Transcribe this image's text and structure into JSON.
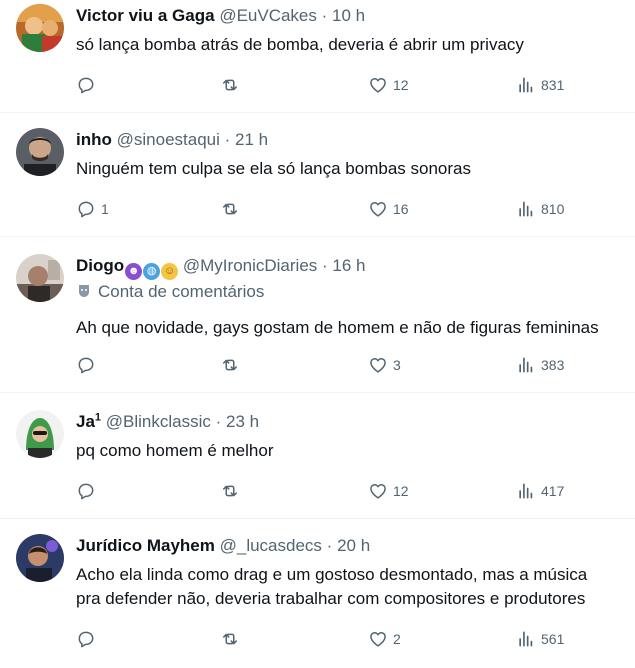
{
  "tweets": [
    {
      "name": "Victor viu a Gaga",
      "handle": "@EuVCakes",
      "time": "10 h",
      "label": "",
      "text": [
        "só lança bomba atrás de bomba, deveria é abrir um privacy"
      ],
      "replies": "",
      "retweets": "",
      "likes": "12",
      "views": "831"
    },
    {
      "name": "inho",
      "handle": "@sinoestaqui",
      "time": "21 h",
      "label": "",
      "text": [
        "Ninguém tem culpa se ela só lança bombas sonoras"
      ],
      "replies": "1",
      "retweets": "",
      "likes": "16",
      "views": "810"
    },
    {
      "name": "Diogo",
      "handle": "@MyIronicDiaries",
      "time": "16 h",
      "label": "Conta de comentários",
      "text": [
        "Ah que novidade, gays gostam de homem e não de figuras femininas"
      ],
      "replies": "",
      "retweets": "",
      "likes": "3",
      "views": "383",
      "emojis": [
        "devil-emoji",
        "globe-emoji",
        "cowboy-emoji"
      ]
    },
    {
      "name": "Ja",
      "name_sup": "1",
      "handle": "@Blinkclassic",
      "time": "23 h",
      "label": "",
      "text": [
        "pq como homem é melhor"
      ],
      "replies": "",
      "retweets": "",
      "likes": "12",
      "views": "417"
    },
    {
      "name": "Jurídico Mayhem",
      "handle": "@_lucasdecs",
      "time": "20 h",
      "label": "",
      "text": [
        "Acho ela linda como drag e um gostoso desmontado, mas a música",
        "pra defender não, deveria trabalhar com compositores e produtores"
      ],
      "replies": "",
      "retweets": "",
      "likes": "2",
      "views": "561"
    }
  ],
  "colors": {
    "text": "#0f1419",
    "secondary": "#536471",
    "divider": "#eff3f4"
  }
}
